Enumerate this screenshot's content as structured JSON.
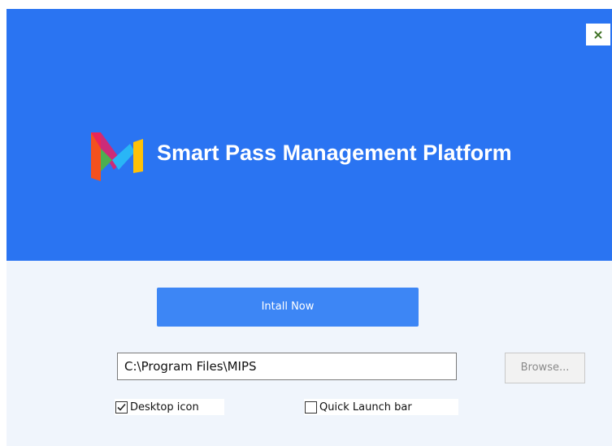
{
  "window": {
    "close_label": "×"
  },
  "header": {
    "title": "Smart Pass Management Platform",
    "logo_icon": "mips-logo-icon"
  },
  "install": {
    "button_label": "Intall Now"
  },
  "path": {
    "value": "C:\\Program Files\\MIPS",
    "browse_label": "Browse..."
  },
  "options": {
    "desktop_icon": {
      "label": "Desktop icon",
      "checked": true
    },
    "quick_launch": {
      "label": "Quick Launch bar",
      "checked": false
    }
  },
  "colors": {
    "hero_bg": "#2a74f2",
    "install_button": "#3d86f5",
    "panel_bg": "#f0f5fc"
  }
}
